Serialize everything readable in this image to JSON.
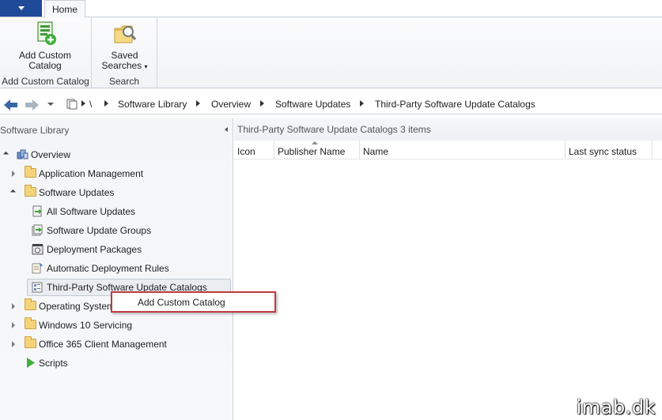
{
  "tabs": {
    "home": "Home"
  },
  "ribbon": {
    "add_custom_catalog": {
      "line1": "Add Custom",
      "line2": "Catalog",
      "group_label": "Add Custom Catalog",
      "icon": "add-catalog-icon"
    },
    "saved_searches": {
      "line1": "Saved",
      "line2": "Searches",
      "group_label": "Search",
      "icon": "saved-searches-icon"
    }
  },
  "address_bar": {
    "root": "\\",
    "crumbs": [
      "Software Library",
      "Overview",
      "Software Updates",
      "Third-Party Software Update Catalogs"
    ]
  },
  "left_pane": {
    "title": "Software Library",
    "tree": [
      {
        "label": "Overview",
        "icon": "overview-icon"
      },
      {
        "label": "Application Management",
        "icon": "folder-icon"
      },
      {
        "label": "Software Updates",
        "icon": "folder-icon"
      },
      {
        "label": "All Software Updates",
        "icon": "software-update-icon"
      },
      {
        "label": "Software Update Groups",
        "icon": "update-group-icon"
      },
      {
        "label": "Deployment Packages",
        "icon": "package-icon"
      },
      {
        "label": "Automatic Deployment Rules",
        "icon": "rules-icon"
      },
      {
        "label": "Third-Party Software Update Catalogs",
        "icon": "catalog-icon"
      },
      {
        "label": "Operating Systems",
        "icon": "folder-icon"
      },
      {
        "label": "Windows 10 Servicing",
        "icon": "folder-icon"
      },
      {
        "label": "Office 365 Client Management",
        "icon": "folder-icon"
      },
      {
        "label": "Scripts",
        "icon": "scripts-icon"
      }
    ]
  },
  "context_menu": {
    "item": "Add Custom Catalog",
    "highlight_color": "#c0393b"
  },
  "right_pane": {
    "title": "Third-Party Software Update Catalogs",
    "count": "3 items",
    "columns": [
      "Icon",
      "Publisher Name",
      "Name",
      "Last sync status"
    ]
  },
  "watermark": "imab.dk",
  "colors": {
    "app_button": "#1f4a98",
    "folder": "#f4d37a"
  }
}
